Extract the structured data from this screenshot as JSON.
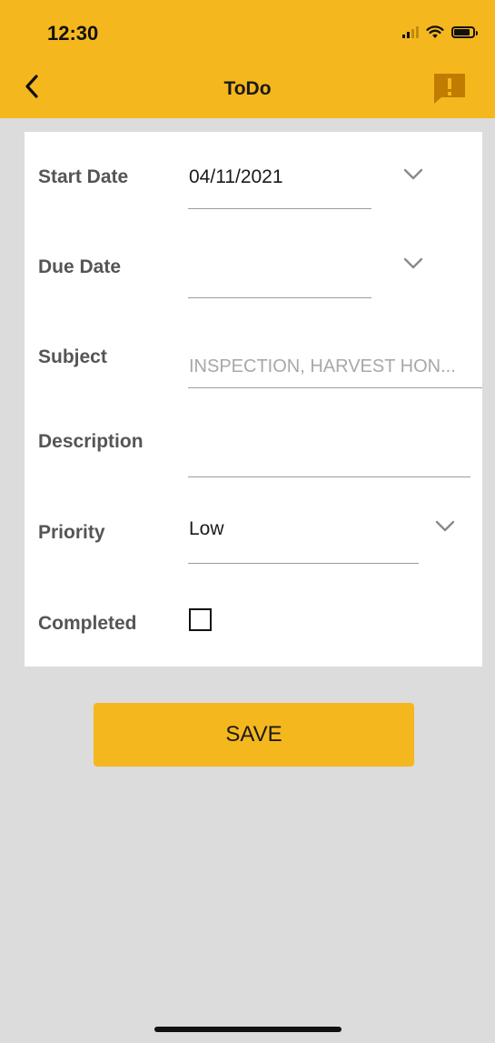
{
  "status_bar": {
    "time": "12:30",
    "icons": [
      "signal-icon",
      "wifi-icon",
      "battery-icon"
    ]
  },
  "app_bar": {
    "title": "ToDo",
    "back_icon": "chevron-left-icon",
    "action_icon": "feedback-alert-icon",
    "color": "#f5b71e"
  },
  "form": {
    "start_date": {
      "label": "Start Date",
      "value": "04/11/2021"
    },
    "due_date": {
      "label": "Due Date",
      "value": ""
    },
    "subject": {
      "label": "Subject",
      "value": "",
      "placeholder": "INSPECTION, HARVEST HON..."
    },
    "description": {
      "label": "Description",
      "value": ""
    },
    "priority": {
      "label": "Priority",
      "value": "Low"
    },
    "completed": {
      "label": "Completed",
      "checked": false
    }
  },
  "save_button": {
    "label": "SAVE"
  },
  "colors": {
    "accent": "#f5b71e",
    "background": "#dcdcdc",
    "card": "#ffffff"
  }
}
